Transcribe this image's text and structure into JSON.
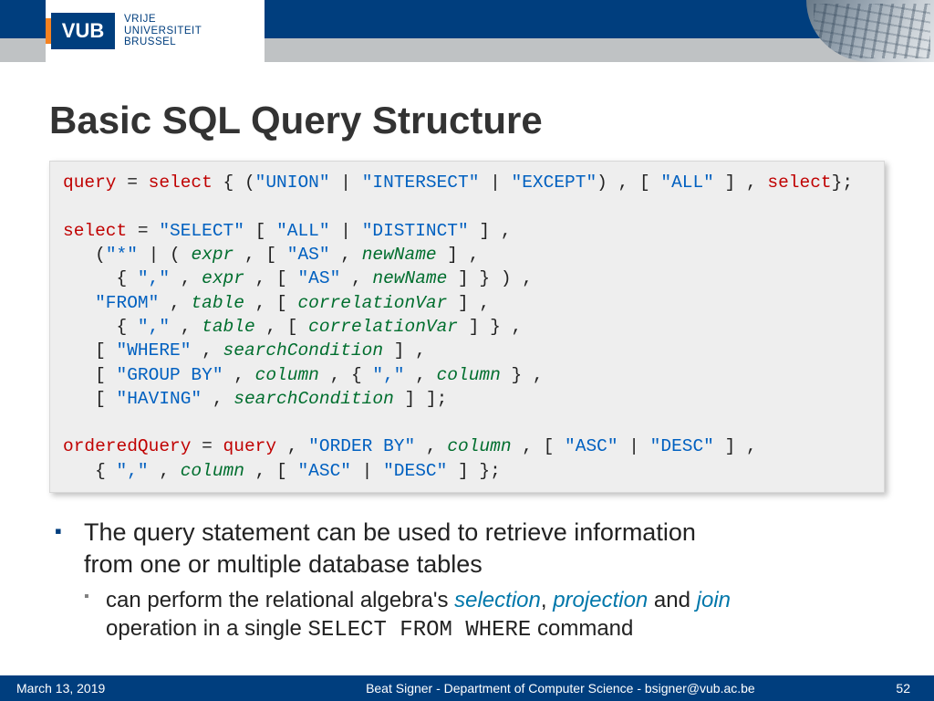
{
  "logo": {
    "mark": "VUB",
    "line1": "VRIJE",
    "line2": "UNIVERSITEIT",
    "line3": "BRUSSEL"
  },
  "title": "Basic SQL Query Structure",
  "bullet1_a": "The query statement can be used to retrieve information",
  "bullet1_b": "from one or multiple database tables",
  "sub_a": "can perform the relational algebra's ",
  "sub_sel": "selection",
  "sub_c1": ", ",
  "sub_proj": "projection",
  "sub_and": " and ",
  "sub_join": "join",
  "sub_b": "operation in a single ",
  "sub_cmd": "SELECT FROM WHERE",
  "sub_tail": " command",
  "footer": {
    "date": "March 13, 2019",
    "author": "Beat Signer - Department of Computer Science - bsigner@vub.ac.be",
    "page": "52"
  },
  "code": {
    "l1": {
      "a": "query",
      "b": " = ",
      "c": "select",
      "d": " { (",
      "e": "\"UNION\"",
      "f": " | ",
      "g": "\"INTERSECT\"",
      "h": " | ",
      "i": "\"EXCEPT\"",
      "j": ") , [ ",
      "k": "\"ALL\"",
      "l": " ] , ",
      "m": "select",
      "n": "};"
    },
    "l3": {
      "a": "select",
      "b": " = ",
      "c": "\"SELECT\"",
      "d": " [ ",
      "e": "\"ALL\"",
      "f": " | ",
      "g": "\"DISTINCT\"",
      "h": " ] ,"
    },
    "l4": {
      "a": "   (",
      "b": "\"*\"",
      "c": " | ( ",
      "d": "expr",
      "e": " , [ ",
      "f": "\"AS\"",
      "g": " , ",
      "h": "newName",
      "i": " ] ,"
    },
    "l5": {
      "a": "     { ",
      "b": "\",\"",
      "c": " , ",
      "d": "expr",
      "e": " , [ ",
      "f": "\"AS\"",
      "g": " , ",
      "h": "newName",
      "i": " ] } ) ,"
    },
    "l6": {
      "a": "   ",
      "b": "\"FROM\"",
      "c": " , ",
      "d": "table",
      "e": " , [ ",
      "f": "correlationVar",
      "g": " ] ,"
    },
    "l7": {
      "a": "     { ",
      "b": "\",\"",
      "c": " , ",
      "d": "table",
      "e": " , [ ",
      "f": "correlationVar",
      "g": " ] } ,"
    },
    "l8": {
      "a": "   [ ",
      "b": "\"WHERE\"",
      "c": " , ",
      "d": "searchCondition",
      "e": " ] ,"
    },
    "l9": {
      "a": "   [ ",
      "b": "\"GROUP BY\"",
      "c": " , ",
      "d": "column",
      "e": " , { ",
      "f": "\",\"",
      "g": " , ",
      "h": "column",
      "i": " } ,"
    },
    "l10": {
      "a": "   [ ",
      "b": "\"HAVING\"",
      "c": " , ",
      "d": "searchCondition",
      "e": " ] ];"
    },
    "l12": {
      "a": "orderedQuery",
      "b": " = ",
      "c": "query",
      "d": " , ",
      "e": "\"ORDER BY\"",
      "f": " , ",
      "g": "column",
      "h": " , [ ",
      "i": "\"ASC\"",
      "j": " | ",
      "k": "\"DESC\"",
      "l": " ] ,"
    },
    "l13": {
      "a": "   { ",
      "b": "\",\"",
      "c": " , ",
      "d": "column",
      "e": " , [ ",
      "f": "\"ASC\"",
      "g": " | ",
      "h": "\"DESC\"",
      "i": " ] };"
    }
  }
}
